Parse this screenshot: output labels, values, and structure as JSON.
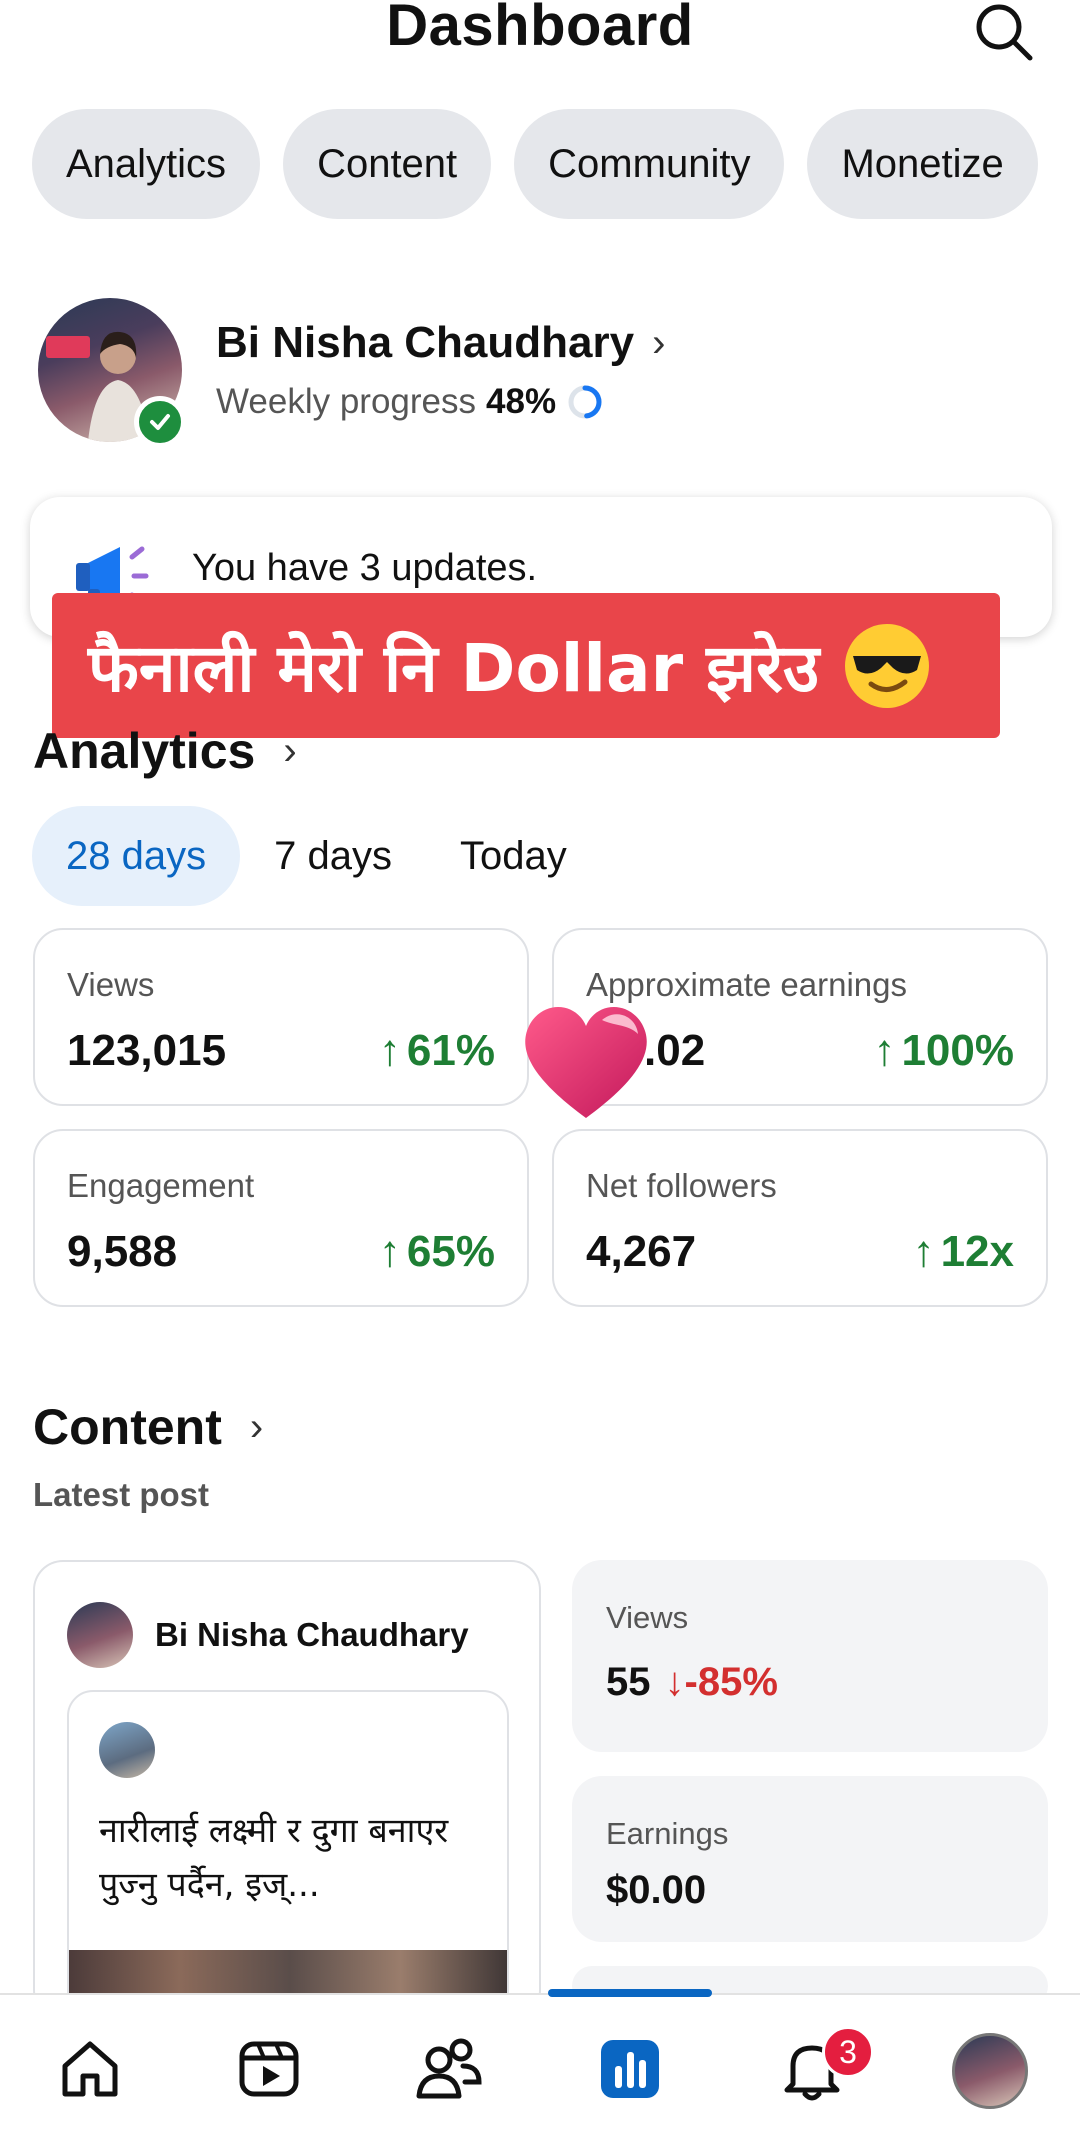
{
  "header": {
    "title": "Dashboard"
  },
  "tabs": [
    "Analytics",
    "Content",
    "Community",
    "Monetize"
  ],
  "profile": {
    "name": "Bi Nisha Chaudhary",
    "progress_label": "Weekly progress",
    "progress_value": "48%",
    "progress_fraction": 0.48
  },
  "updates": {
    "text": "You have 3 updates."
  },
  "overlay_banner": {
    "text": "फैनाली मेरो नि Dollar झरेउ"
  },
  "analytics": {
    "title": "Analytics",
    "periods": [
      "28 days",
      "7 days",
      "Today"
    ],
    "active_period": "28 days",
    "stats": [
      {
        "label": "Views",
        "value": "123,015",
        "change": "61%"
      },
      {
        "label": "Approximate earnings",
        "value": ".02",
        "change": "100%"
      },
      {
        "label": "Engagement",
        "value": "9,588",
        "change": "65%"
      },
      {
        "label": "Net followers",
        "value": "4,267",
        "change": "12x"
      }
    ]
  },
  "content": {
    "title": "Content",
    "subtitle": "Latest post",
    "post": {
      "author": "Bi Nisha Chaudhary",
      "text": "नारीलाई लक्ष्मी र दुगा बनाएर पुज्नु पर्दैन, इज्..."
    },
    "metrics": {
      "views_label": "Views",
      "views_value": "55",
      "views_change": "-85%",
      "earnings_label": "Earnings",
      "earnings_value": "$0.00"
    }
  },
  "bottom_nav": {
    "items": [
      "home-icon",
      "video-icon",
      "friends-icon",
      "dashboard-icon",
      "notifications-icon",
      "profile-avatar"
    ],
    "active": "dashboard-icon",
    "notification_count": "3"
  },
  "colors": {
    "accent": "#0a66c2",
    "positive": "#1e7e34",
    "negative": "#d32f2f",
    "banner": "#e9454a",
    "badge": "#e41e3f"
  }
}
